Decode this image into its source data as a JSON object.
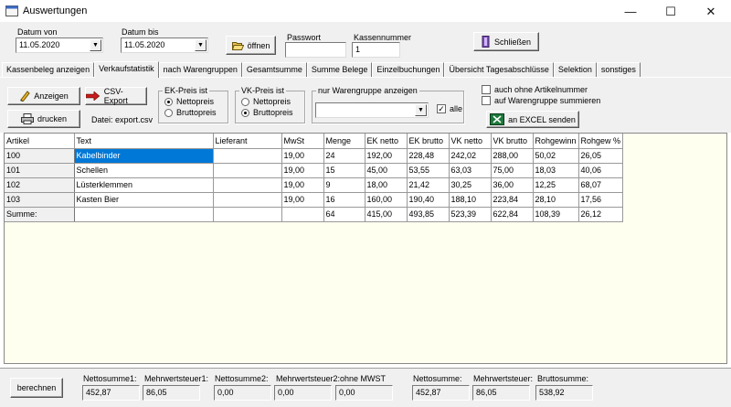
{
  "window": {
    "title": "Auswertungen",
    "minimize": "—",
    "maximize": "☐",
    "close": "✕"
  },
  "top": {
    "datum_von_label": "Datum von",
    "datum_von_value": "11.05.2020",
    "datum_bis_label": "Datum bis",
    "datum_bis_value": "11.05.2020",
    "oeffnen_label": "öffnen",
    "passwort_label": "Passwort",
    "passwort_value": "",
    "kassennummer_label": "Kassennummer",
    "kassennummer_value": "1",
    "schliessen_label": "Schließen"
  },
  "tabs": [
    {
      "label": "Kassenbeleg anzeigen"
    },
    {
      "label": "Verkaufstatistik"
    },
    {
      "label": "nach Warengruppen"
    },
    {
      "label": "Gesamtsumme"
    },
    {
      "label": "Summe Belege"
    },
    {
      "label": "Einzelbuchungen"
    },
    {
      "label": "Übersicht Tagesabschlüsse"
    },
    {
      "label": "Selektion"
    },
    {
      "label": "sonstiges"
    }
  ],
  "toolbar": {
    "anzeigen_label": "Anzeigen",
    "csv_export_label": "CSV-Export",
    "drucken_label": "drucken",
    "datei_label": "Datei: export.csv",
    "ek_preis_title": "EK-Preis ist",
    "ek_netto_label": "Nettopreis",
    "ek_brutto_label": "Bruttopreis",
    "vk_preis_title": "VK-Preis ist",
    "vk_netto_label": "Nettopreis",
    "vk_brutto_label": "Bruttopreis",
    "warengruppe_title": "nur Warengruppe anzeigen",
    "warengruppe_value": "",
    "alle_label": "alle",
    "alle_mark": "✓",
    "ohne_artikelnummer_label": "auch ohne Artikelnummer",
    "auf_warengruppe_label": "auf Warengruppe summieren",
    "excel_label": "an EXCEL senden"
  },
  "table": {
    "headers": [
      "Artikel",
      "Text",
      "Lieferant",
      "MwSt",
      "Menge",
      "EK netto",
      "EK brutto",
      "VK netto",
      "VK brutto",
      "Rohgewinn",
      "Rohgew %"
    ],
    "rows": [
      [
        "100",
        "Kabelbinder",
        "",
        "19,00",
        "24",
        "192,00",
        "228,48",
        "242,02",
        "288,00",
        "50,02",
        "26,05"
      ],
      [
        "101",
        "Schellen",
        "",
        "19,00",
        "15",
        "45,00",
        "53,55",
        "63,03",
        "75,00",
        "18,03",
        "40,06"
      ],
      [
        "102",
        "Lüsterklemmen",
        "",
        "19,00",
        "9",
        "18,00",
        "21,42",
        "30,25",
        "36,00",
        "12,25",
        "68,07"
      ],
      [
        "103",
        "Kasten Bier",
        "",
        "19,00",
        "16",
        "160,00",
        "190,40",
        "188,10",
        "223,84",
        "28,10",
        "17,56"
      ],
      [
        "Summe:",
        "",
        "",
        "",
        "64",
        "415,00",
        "493,85",
        "523,39",
        "622,84",
        "108,39",
        "26,12"
      ]
    ]
  },
  "bottom": {
    "berechnen_label": "berechnen",
    "nettosumme1_label": "Nettosumme1:",
    "nettosumme1_value": "452,87",
    "mwst1_label": "Mehrwertsteuer1:",
    "mwst1_value": "86,05",
    "nettosumme2_label": "Nettosumme2:",
    "nettosumme2_value": "0,00",
    "mwst2_label": "Mehrwertsteuer2:",
    "mwst2_value": "0,00",
    "ohne_mwst_label": "ohne MWST",
    "ohne_mwst_value": "0,00",
    "nettosumme_label": "Nettosumme:",
    "nettosumme_value": "452,87",
    "mwst_label": "Mehrwertsteuer:",
    "mwst_value": "86,05",
    "bruttosumme_label": "Bruttosumme:",
    "bruttosumme_value": "538,92"
  }
}
